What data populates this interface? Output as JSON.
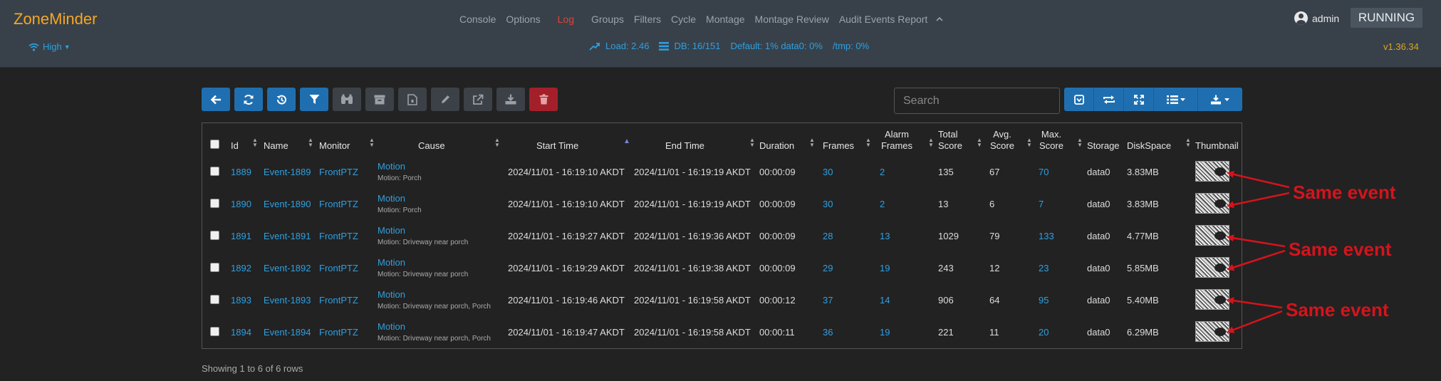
{
  "brand": "ZoneMinder",
  "nav": {
    "links": [
      "Console",
      "Options",
      "Log",
      "Groups",
      "Filters",
      "Cycle",
      "Montage",
      "Montage Review",
      "Audit Events Report"
    ],
    "active": "Log",
    "collapse_icon": "chevron-up-icon"
  },
  "user": {
    "name": "admin",
    "icon": "user-circle-icon"
  },
  "status": "RUNNING",
  "bandwidth": {
    "label": "High",
    "icon": "wifi-icon"
  },
  "stats": {
    "load": "Load: 2.46",
    "db": "DB: 16/151",
    "disk": "Default: 1% data0: 0%",
    "tmp": "/tmp: 0%"
  },
  "version": "v1.36.34",
  "toolbar": {
    "buttons": [
      "back-icon",
      "refresh-icon",
      "history-icon",
      "filter-icon",
      "binoculars-icon",
      "archive-icon",
      "unarchive-icon",
      "edit-icon",
      "export-icon",
      "download-icon",
      "delete-icon"
    ]
  },
  "search": {
    "placeholder": "Search",
    "value": ""
  },
  "right_toolbar": {
    "buttons": [
      "toggle-icon",
      "refresh-icon",
      "fullscreen-icon",
      "columns-icon",
      "export-icon"
    ]
  },
  "table": {
    "columns": [
      {
        "key": "id",
        "label": "Id"
      },
      {
        "key": "name",
        "label": "Name"
      },
      {
        "key": "monitor",
        "label": "Monitor"
      },
      {
        "key": "cause",
        "label": "Cause"
      },
      {
        "key": "start",
        "label": "Start Time"
      },
      {
        "key": "end",
        "label": "End Time"
      },
      {
        "key": "duration",
        "label": "Duration"
      },
      {
        "key": "frames",
        "label": "Frames"
      },
      {
        "key": "alarm_frames",
        "label": "Alarm Frames"
      },
      {
        "key": "total_score",
        "label": "Total Score"
      },
      {
        "key": "avg_score",
        "label": "Avg. Score"
      },
      {
        "key": "max_score",
        "label": "Max. Score"
      },
      {
        "key": "storage",
        "label": "Storage"
      },
      {
        "key": "disk_space",
        "label": "DiskSpace"
      },
      {
        "key": "thumbnail",
        "label": "Thumbnail"
      }
    ],
    "rows": [
      {
        "id": "1889",
        "name": "Event-1889",
        "monitor": "FrontPTZ",
        "cause": "Motion",
        "note": "Motion: Porch",
        "start": "2024/11/01 - 16:19:10 AKDT",
        "end": "2024/11/01 - 16:19:19 AKDT",
        "duration": "00:00:09",
        "frames": "30",
        "alarm_frames": "2",
        "total_score": "135",
        "avg_score": "67",
        "max_score": "70",
        "storage": "data0",
        "disk_space": "3.83MB"
      },
      {
        "id": "1890",
        "name": "Event-1890",
        "monitor": "FrontPTZ",
        "cause": "Motion",
        "note": "Motion: Porch",
        "start": "2024/11/01 - 16:19:10 AKDT",
        "end": "2024/11/01 - 16:19:19 AKDT",
        "duration": "00:00:09",
        "frames": "30",
        "alarm_frames": "2",
        "total_score": "13",
        "avg_score": "6",
        "max_score": "7",
        "storage": "data0",
        "disk_space": "3.83MB"
      },
      {
        "id": "1891",
        "name": "Event-1891",
        "monitor": "FrontPTZ",
        "cause": "Motion",
        "note": "Motion: Driveway near porch",
        "start": "2024/11/01 - 16:19:27 AKDT",
        "end": "2024/11/01 - 16:19:36 AKDT",
        "duration": "00:00:09",
        "frames": "28",
        "alarm_frames": "13",
        "total_score": "1029",
        "avg_score": "79",
        "max_score": "133",
        "storage": "data0",
        "disk_space": "4.77MB"
      },
      {
        "id": "1892",
        "name": "Event-1892",
        "monitor": "FrontPTZ",
        "cause": "Motion",
        "note": "Motion: Driveway near porch",
        "start": "2024/11/01 - 16:19:29 AKDT",
        "end": "2024/11/01 - 16:19:38 AKDT",
        "duration": "00:00:09",
        "frames": "29",
        "alarm_frames": "19",
        "total_score": "243",
        "avg_score": "12",
        "max_score": "23",
        "storage": "data0",
        "disk_space": "5.85MB"
      },
      {
        "id": "1893",
        "name": "Event-1893",
        "monitor": "FrontPTZ",
        "cause": "Motion",
        "note": "Motion: Driveway near porch, Porch",
        "start": "2024/11/01 - 16:19:46 AKDT",
        "end": "2024/11/01 - 16:19:58 AKDT",
        "duration": "00:00:12",
        "frames": "37",
        "alarm_frames": "14",
        "total_score": "906",
        "avg_score": "64",
        "max_score": "95",
        "storage": "data0",
        "disk_space": "5.40MB"
      },
      {
        "id": "1894",
        "name": "Event-1894",
        "monitor": "FrontPTZ",
        "cause": "Motion",
        "note": "Motion: Driveway near porch, Porch",
        "start": "2024/11/01 - 16:19:47 AKDT",
        "end": "2024/11/01 - 16:19:58 AKDT",
        "duration": "00:00:11",
        "frames": "36",
        "alarm_frames": "19",
        "total_score": "221",
        "avg_score": "11",
        "max_score": "20",
        "storage": "data0",
        "disk_space": "6.29MB"
      }
    ],
    "footer": "Showing 1 to 6 of 6 rows"
  },
  "annotations": {
    "label": "Same event",
    "color": "#d4141c"
  }
}
